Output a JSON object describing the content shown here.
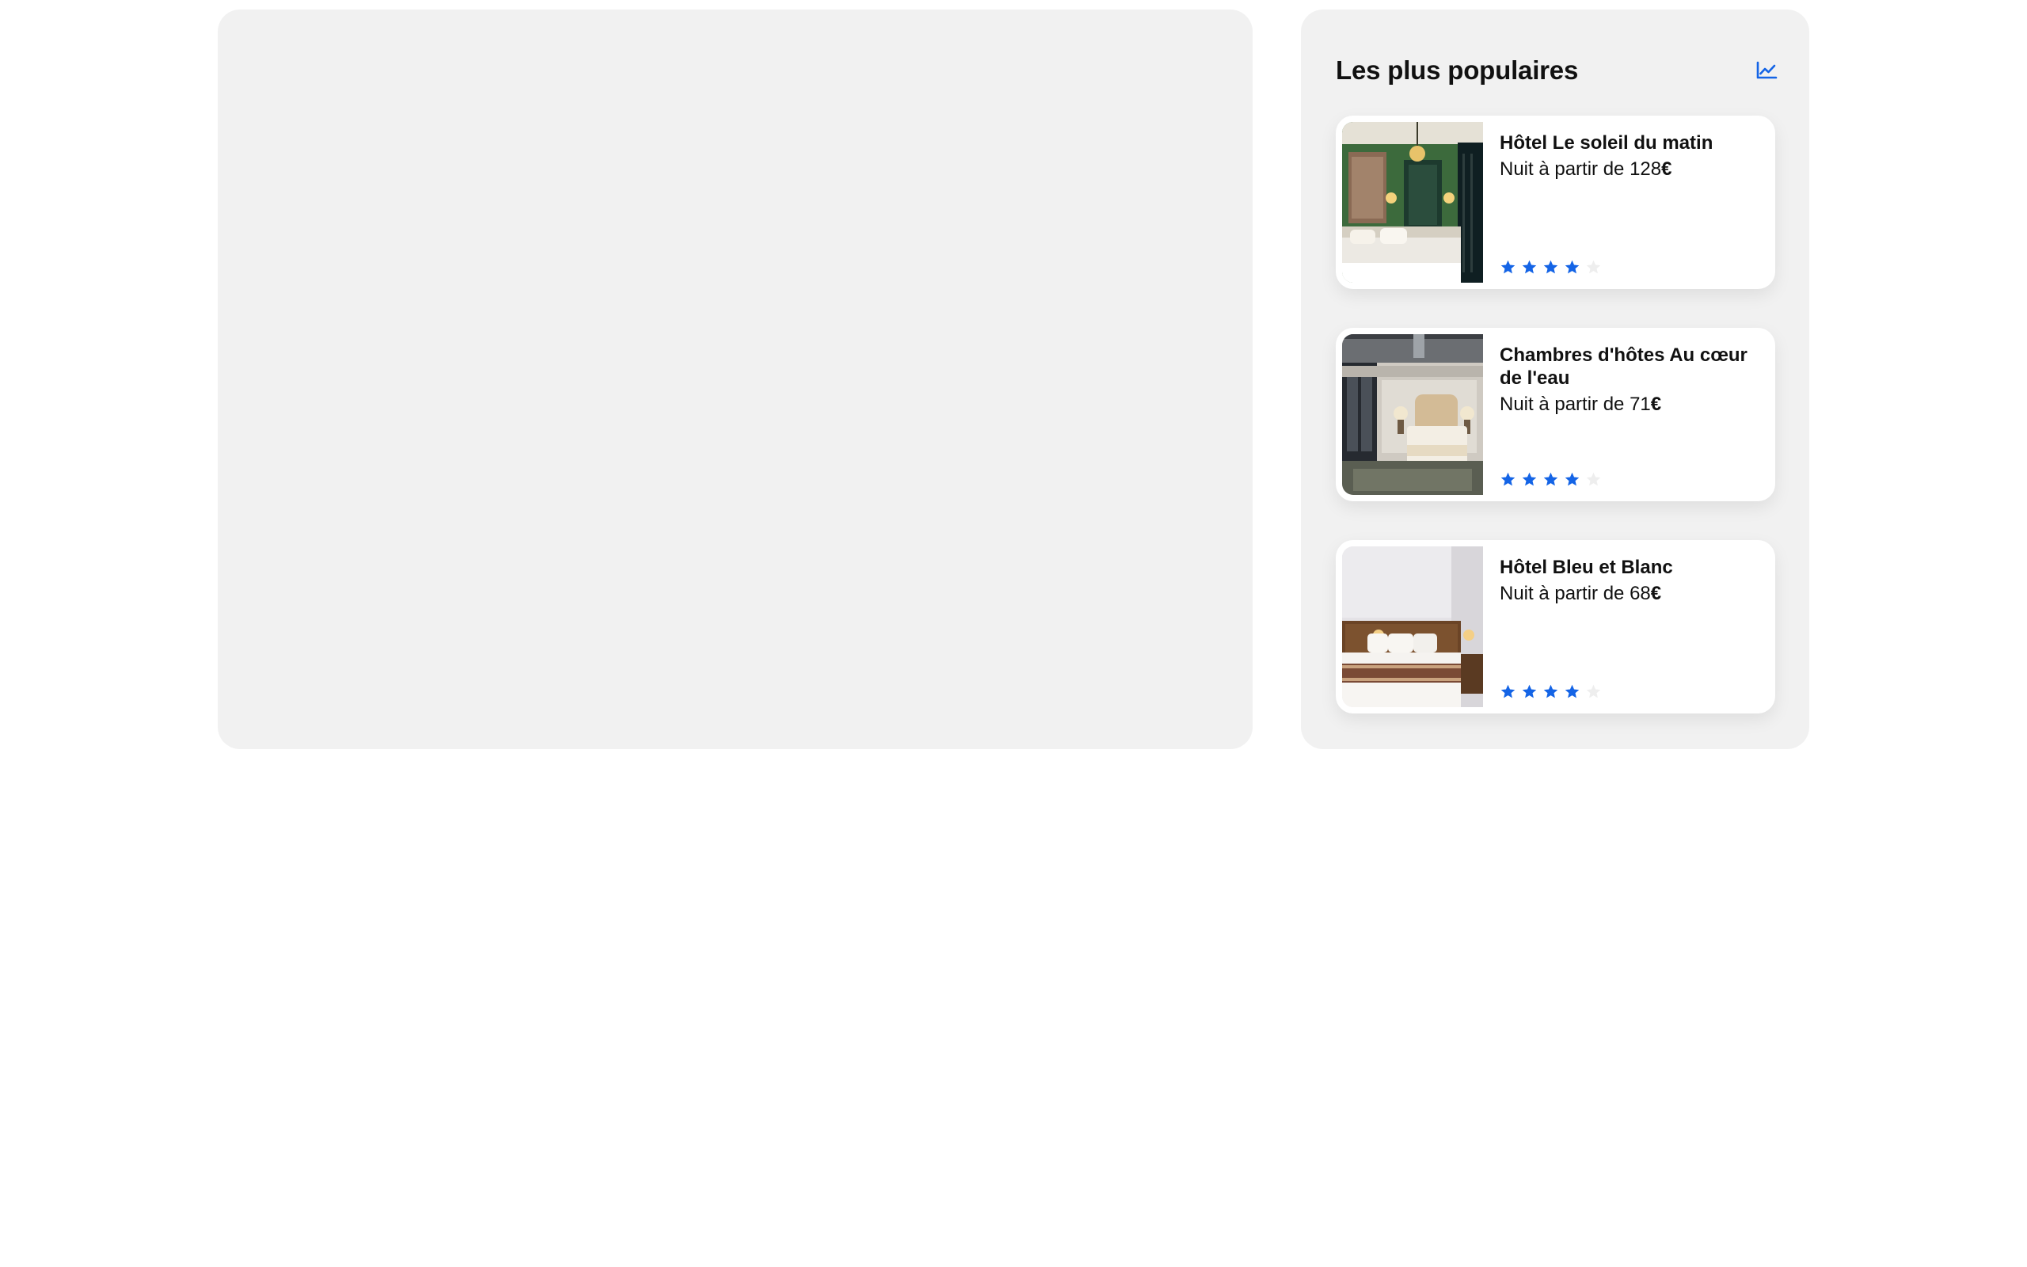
{
  "popular": {
    "title": "Les plus populaires",
    "trend_icon": "chart-line-icon",
    "accent_color": "#1464e6",
    "price_prefix": "Nuit à partir de ",
    "currency": "€",
    "hotels": [
      {
        "name": "Hôtel Le soleil du matin",
        "price": "128",
        "rating": 4,
        "rating_max": 5
      },
      {
        "name": "Chambres d'hôtes Au cœur de l'eau",
        "price": "71",
        "rating": 4,
        "rating_max": 5
      },
      {
        "name": "Hôtel Bleu et Blanc",
        "price": "68",
        "rating": 4,
        "rating_max": 5
      }
    ]
  }
}
